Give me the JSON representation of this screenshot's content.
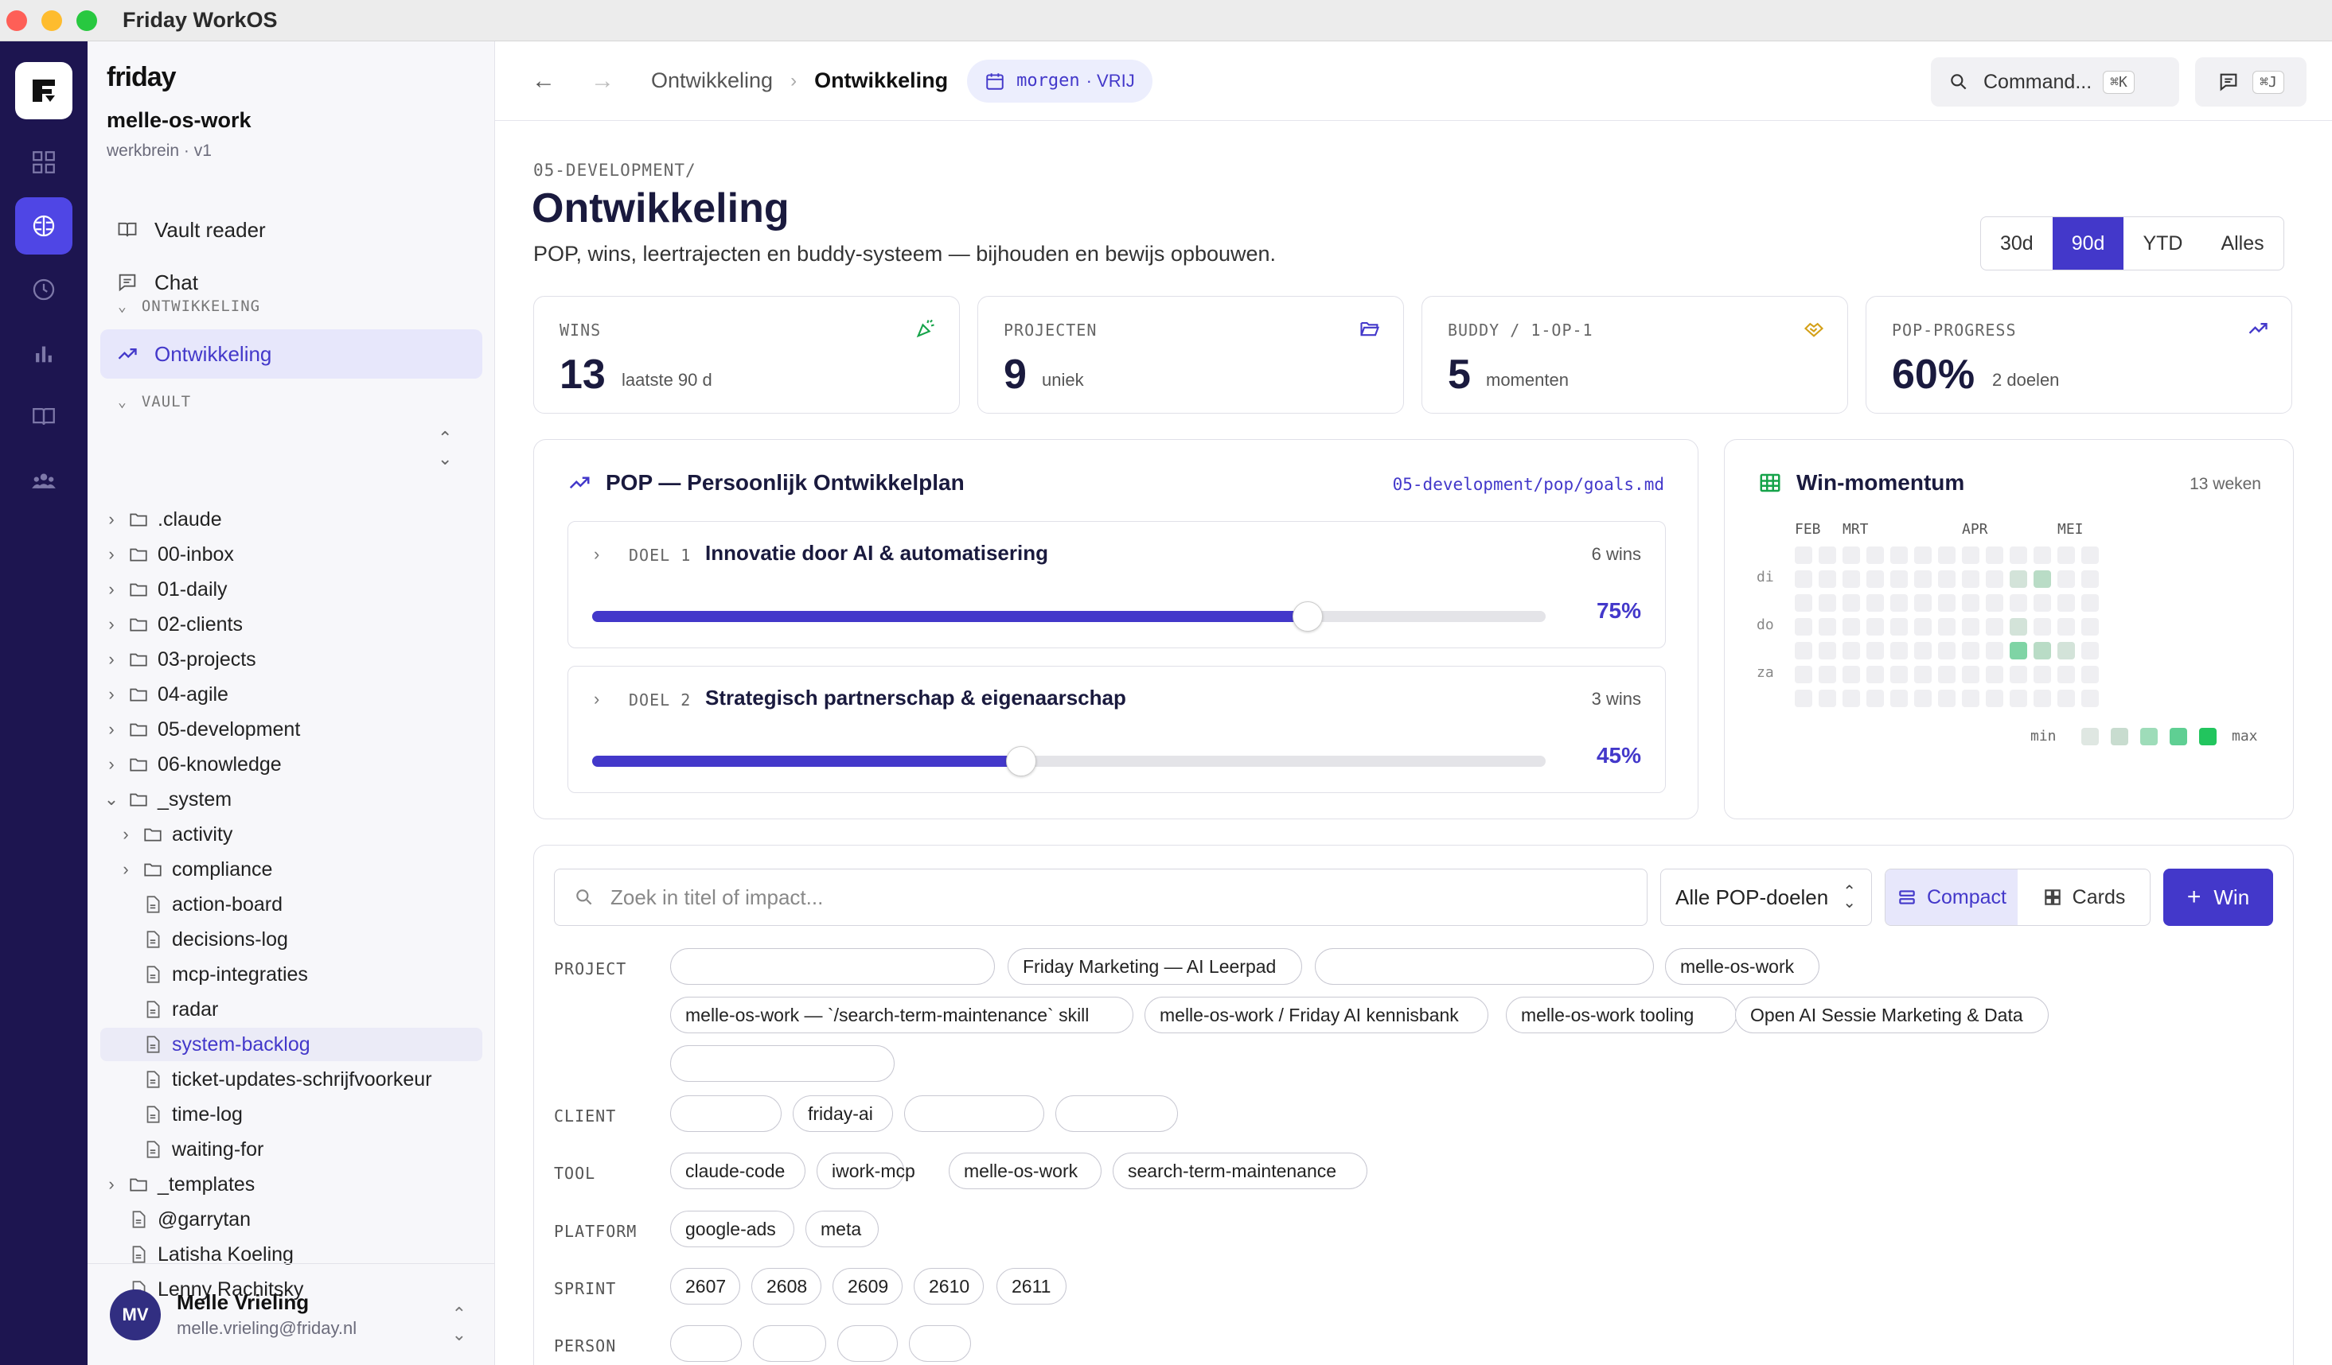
{
  "window": {
    "title": "Friday WorkOS"
  },
  "sidebar": {
    "brand": "friday",
    "workspace": "melle-os-work",
    "workspace_sub": "werkbrein · v1",
    "nav": {
      "vault_reader": "Vault reader",
      "chat": "Chat"
    },
    "section_ontwikkeling": "ONTWIKKELING",
    "ontwikkeling_item": "Ontwikkeling",
    "section_vault": "VAULT",
    "tree": [
      {
        "label": ".claude"
      },
      {
        "label": "00-inbox"
      },
      {
        "label": "01-daily"
      },
      {
        "label": "02-clients"
      },
      {
        "label": "03-projects"
      },
      {
        "label": "04-agile"
      },
      {
        "label": "05-development"
      },
      {
        "label": "06-knowledge"
      },
      {
        "label": "_system"
      },
      {
        "label": "activity"
      },
      {
        "label": "compliance"
      },
      {
        "label": "action-board"
      },
      {
        "label": "decisions-log"
      },
      {
        "label": "mcp-integraties"
      },
      {
        "label": "radar"
      },
      {
        "label": "system-backlog"
      },
      {
        "label": "ticket-updates-schrijfvoorkeur"
      },
      {
        "label": "time-log"
      },
      {
        "label": "waiting-for"
      },
      {
        "label": "_templates"
      },
      {
        "label": "@garrytan"
      },
      {
        "label": "Latisha Koeling"
      },
      {
        "label": "Lenny Rachitsky"
      }
    ],
    "user": {
      "initials": "MV",
      "name": "Melle Vrieling",
      "email": "melle.vrieling@friday.nl"
    }
  },
  "topbar": {
    "crumb_parent": "Ontwikkeling",
    "crumb_current": "Ontwikkeling",
    "date_day": "morgen",
    "date_status": "· VRIJ",
    "command_label": "Command...",
    "command_kbd": "⌘K",
    "chat_kbd": "⌘J"
  },
  "main": {
    "path": "05-DEVELOPMENT/",
    "title": "Ontwikkeling",
    "subtitle": "POP, wins, leertrajecten en buddy-systeem — bijhouden en bewijs opbouwen.",
    "ranges": [
      "30d",
      "90d",
      "YTD",
      "Alles"
    ],
    "active_range": "90d"
  },
  "stats": [
    {
      "label": "WINS",
      "value": "13",
      "unit": "laatste 90 d",
      "icon": "party-popper-icon",
      "color": "#16a34a"
    },
    {
      "label": "PROJECTEN",
      "value": "9",
      "unit": "uniek",
      "icon": "folder-open-icon",
      "color": "#4338ca"
    },
    {
      "label": "BUDDY / 1-OP-1",
      "value": "5",
      "unit": "momenten",
      "icon": "handshake-icon",
      "color": "#d4a017"
    },
    {
      "label": "POP-PROGRESS",
      "value": "60%",
      "unit": "2 doelen",
      "icon": "trending-up-icon",
      "color": "#4338ca"
    }
  ],
  "pop": {
    "title": "POP — Persoonlijk Ontwikkelplan",
    "file": "05-development/pop/goals.md",
    "goals": [
      {
        "tag": "DOEL 1",
        "name": "Innovatie door AI & automatisering",
        "wins": "6 wins",
        "pct_label": "75%",
        "progress": 75
      },
      {
        "tag": "DOEL 2",
        "name": "Strategisch partnerschap & eigenaarschap",
        "wins": "3 wins",
        "pct_label": "45%",
        "progress": 45
      }
    ]
  },
  "momentum": {
    "title": "Win-momentum",
    "weeks_label": "13 weken",
    "months": [
      {
        "label": "FEB",
        "week": 0
      },
      {
        "label": "MRT",
        "week": 2
      },
      {
        "label": "APR",
        "week": 7
      },
      {
        "label": "MEI",
        "week": 11
      }
    ],
    "days": [
      {
        "label": "di",
        "row": 1
      },
      {
        "label": "do",
        "row": 3
      },
      {
        "label": "za",
        "row": 5
      }
    ],
    "levels": [
      "0000000000000",
      "0000000001200",
      "0000000000000",
      "0000000001000",
      "0000000003210",
      "0000000000000",
      "0000000000000"
    ],
    "legend_min": "min",
    "legend_max": "max",
    "level_colors": [
      "#efeff2",
      "#dfe7e2",
      "#c8dccf",
      "#9edcb9",
      "#5fcf93",
      "#22c55e"
    ]
  },
  "filters": {
    "search_placeholder": "Zoek in titel of impact...",
    "select_value": "Alle POP-doelen",
    "view_compact": "Compact",
    "view_cards": "Cards",
    "win_button": "Win",
    "facets": {
      "project": {
        "label": "PROJECT",
        "chips": [
          "",
          "Friday Marketing — AI Leerpad",
          "",
          "melle-os-work",
          "melle-os-work — `/search-term-maintenance` skill",
          "melle-os-work / Friday AI kennisbank",
          "melle-os-work tooling",
          "Open AI Sessie Marketing & Data",
          ""
        ]
      },
      "client": {
        "label": "CLIENT",
        "chips": [
          "",
          "friday-ai",
          "",
          ""
        ]
      },
      "tool": {
        "label": "TOOL",
        "chips": [
          "claude-code",
          "iwork-mcp",
          "melle-os-work",
          "search-term-maintenance"
        ]
      },
      "platform": {
        "label": "PLATFORM",
        "chips": [
          "google-ads",
          "meta"
        ]
      },
      "sprint": {
        "label": "SPRINT",
        "chips": [
          "2607",
          "2608",
          "2609",
          "2610",
          "2611"
        ]
      },
      "person": {
        "label": "PERSON",
        "chips": [
          "",
          "",
          "",
          ""
        ]
      }
    }
  }
}
